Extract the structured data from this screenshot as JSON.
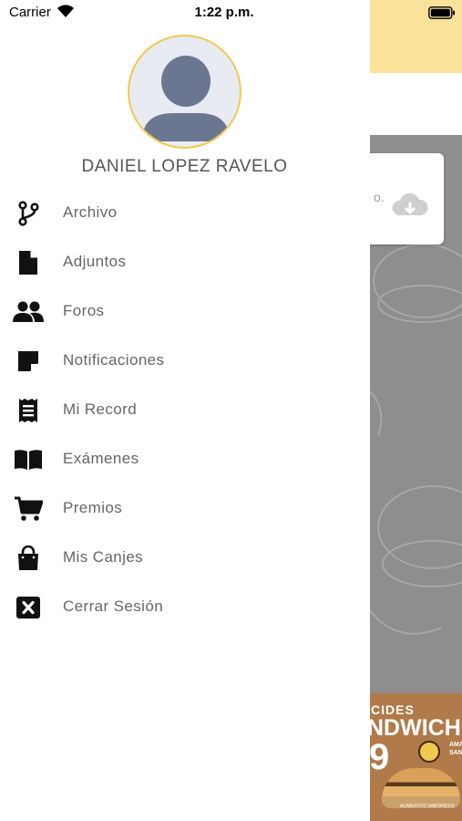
{
  "status_bar": {
    "carrier": "Carrier",
    "time": "1:22 p.m."
  },
  "profile": {
    "name": "DANIEL LOPEZ RAVELO"
  },
  "menu": {
    "items": [
      {
        "label": "Archivo",
        "icon": "branch-icon"
      },
      {
        "label": "Adjuntos",
        "icon": "file-icon"
      },
      {
        "label": "Foros",
        "icon": "users-icon"
      },
      {
        "label": "Notificaciones",
        "icon": "sticky-note-icon"
      },
      {
        "label": "Mi Record",
        "icon": "receipt-icon"
      },
      {
        "label": "Exámenes",
        "icon": "book-icon"
      },
      {
        "label": "Premios",
        "icon": "cart-icon"
      },
      {
        "label": "Mis Canjes",
        "icon": "shopping-bag-icon"
      },
      {
        "label": "Cerrar Sesión",
        "icon": "close-square-icon"
      }
    ]
  },
  "background": {
    "card_text": "o.",
    "banner_top": "CIDES",
    "banner_big": "NDWICH",
    "banner_num": "9",
    "banner_side": "AMA SANI",
    "banner_bottom": "ALIMENTOS SABORIDOS"
  },
  "colors": {
    "header_yellow": "#fbe29b",
    "avatar_border": "#f2c94c",
    "icon": "#111111",
    "label": "#666666"
  }
}
